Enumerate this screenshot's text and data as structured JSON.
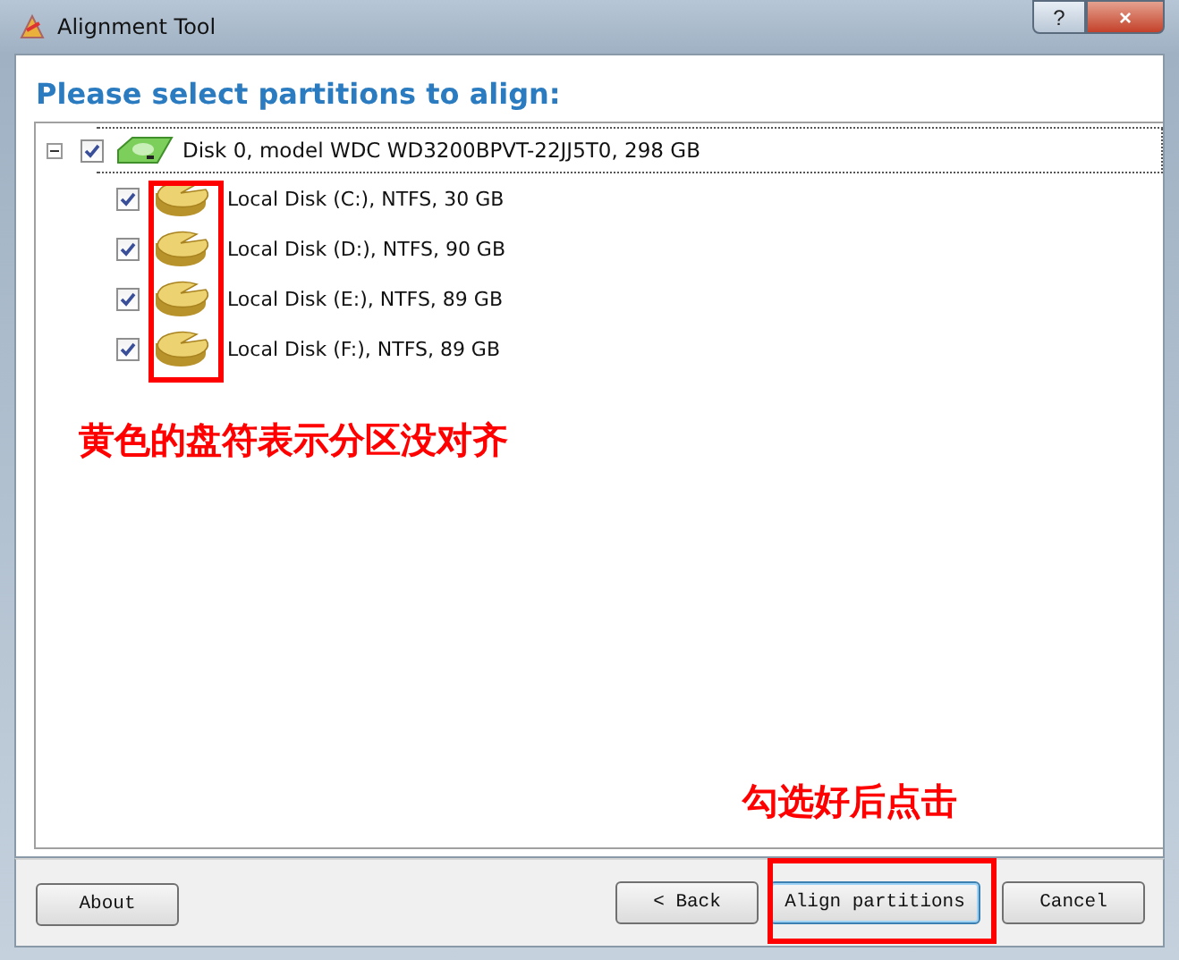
{
  "window": {
    "title": "Alignment Tool",
    "controls": [
      "?",
      "×"
    ]
  },
  "heading": "Please select partitions to align:",
  "tree": {
    "label": "Disk 0, model WDC WD3200BPVT-22JJ5T0, 298 GB",
    "checked": true,
    "expanded": true,
    "children": [
      {
        "label": "Local Disk (C:), NTFS, 30 GB",
        "checked": true
      },
      {
        "label": "Local Disk (D:), NTFS, 90 GB",
        "checked": true
      },
      {
        "label": "Local Disk (E:), NTFS, 89 GB",
        "checked": true
      },
      {
        "label": "Local Disk (F:), NTFS, 89 GB",
        "checked": true
      }
    ]
  },
  "annotations": [
    {
      "text": "黄色的盘符表示分区没对齐"
    },
    {
      "text": "勾选好后点击"
    }
  ],
  "buttons": [
    {
      "label": "About",
      "kind": "left"
    },
    {
      "label": "< Back",
      "kind": "right"
    },
    {
      "label": "Align partitions",
      "kind": "default"
    },
    {
      "label": "Cancel",
      "kind": "right"
    }
  ]
}
